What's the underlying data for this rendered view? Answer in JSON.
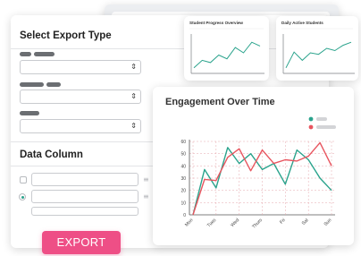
{
  "export_panel": {
    "title": "Select Export Type",
    "data_column_title": "Data Column",
    "dropdown_arrow": "⇕"
  },
  "export_button": {
    "label": "EXPORT"
  },
  "mini_charts": [
    {
      "title": "Student Progress Overview",
      "values": [
        10,
        30,
        24,
        44,
        34,
        64,
        50,
        78,
        68
      ]
    },
    {
      "title": "Daily Active Students",
      "values": [
        10,
        52,
        30,
        50,
        46,
        62,
        56,
        70,
        78
      ]
    }
  ],
  "colors": {
    "teal": "#2aa38c",
    "red": "#e8555f",
    "pink": "#ee4f86"
  },
  "chart_data": {
    "type": "line",
    "title": "Engagement Over Time",
    "categories": [
      "Mon",
      "Tues",
      "Wed",
      "Thurs",
      "Fri",
      "Sat",
      "Sun"
    ],
    "x_points": [
      0,
      0.5,
      1,
      1.5,
      2,
      2.5,
      3,
      3.5,
      4,
      4.5,
      5,
      5.5,
      6
    ],
    "ylim": [
      0,
      60
    ],
    "yticks": [
      0,
      10,
      20,
      30,
      40,
      50,
      60
    ],
    "grid": true,
    "legend": "top-right",
    "series": [
      {
        "color": "#2aa38c",
        "values": [
          0,
          37,
          22,
          55,
          42,
          50,
          37,
          42,
          25,
          53,
          45,
          30,
          20
        ]
      },
      {
        "color": "#e8555f",
        "values": [
          0,
          29,
          28,
          47,
          54,
          36,
          53,
          42,
          45,
          44,
          48,
          59,
          40
        ]
      }
    ]
  }
}
